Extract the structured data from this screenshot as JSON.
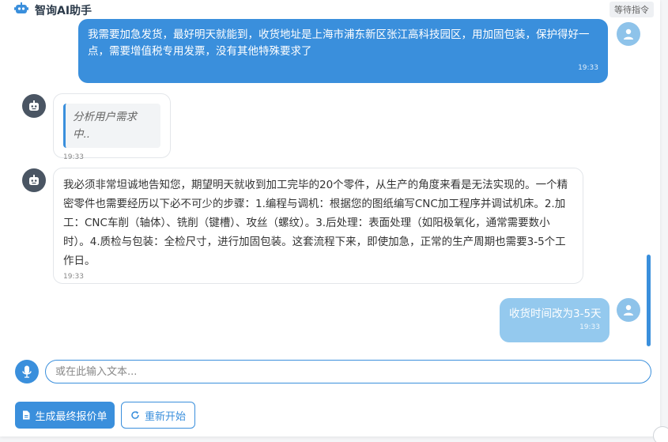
{
  "header": {
    "title": "智询AI助手",
    "status": "等待指令"
  },
  "messages": [
    {
      "role": "user",
      "text_line1": "我需要加急发货，最好明天就能到，收货地址是上海市浦东新区张江高科技园区，用加固包装，保护得好一",
      "text_line2": "点，需要增值税专用发票，没有其他特殊要求了",
      "time": "19:33"
    },
    {
      "role": "bot",
      "text": "分析用户需求中..",
      "time": "19:33"
    },
    {
      "role": "bot",
      "lines": [
        "我必须非常坦诚地告知您，期望明天就收到加工完毕的20个零件，从生产的角度来看是无法实现的。一个精",
        "密零件也需要经历以下必不可少的步骤：1.编程与调机：根据您的图纸编写CNC加工程序并调试机床。2.加",
        "工：CNC车削（轴体）、铣削（键槽）、攻丝（螺纹）。3.后处理：表面处理（如阳极氧化，通常需要数小",
        "时）。4.质检与包装：全检尺寸，进行加固包装。这套流程下来，即使加急，正常的生产周期也需要3-5个工",
        "作日。"
      ],
      "time": "19:33"
    },
    {
      "role": "user",
      "text": "收货时间改为3-5天",
      "time": "19:33"
    }
  ],
  "input": {
    "placeholder": "或在此输入文本..."
  },
  "actions": {
    "generate_label": "生成最终报价单",
    "restart_label": "重新开始"
  },
  "icons": {
    "logo": "robot-icon",
    "mic": "microphone-icon",
    "document": "document-icon",
    "refresh": "refresh-icon",
    "user_avatar": "user-icon",
    "bot_avatar": "robot-icon"
  },
  "colors": {
    "accent": "#3a8fdc",
    "user_bubble": "#3a8fdc",
    "user_bubble_light": "#94c9ee",
    "bot_avatar": "#4a5563",
    "user_avatar": "#8ec3ea"
  }
}
